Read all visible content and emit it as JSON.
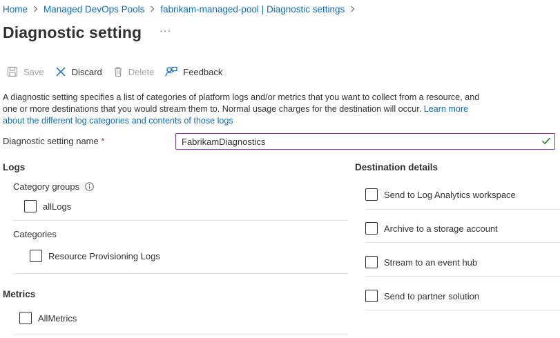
{
  "breadcrumb": [
    {
      "label": "Home"
    },
    {
      "label": "Managed DevOps Pools"
    },
    {
      "label": "fabrikam-managed-pool | Diagnostic settings"
    }
  ],
  "page_title": "Diagnostic setting",
  "more_label": "···",
  "toolbar": {
    "save": "Save",
    "discard": "Discard",
    "delete": "Delete",
    "feedback": "Feedback"
  },
  "description": {
    "text": "A diagnostic setting specifies a list of categories of platform logs and/or metrics that you want to collect from a resource, and one or more destinations that you would stream them to. Normal usage charges for the destination will occur. ",
    "link": "Learn more about the different log categories and contents of those logs"
  },
  "setting_name": {
    "label": "Diagnostic setting name",
    "required_mark": "*",
    "value": "FabrikamDiagnostics"
  },
  "logs": {
    "heading": "Logs",
    "category_groups_label": "Category groups",
    "category_groups": [
      {
        "label": "allLogs",
        "checked": false
      }
    ],
    "categories_label": "Categories",
    "categories": [
      {
        "label": "Resource Provisioning Logs",
        "checked": false
      }
    ]
  },
  "metrics": {
    "heading": "Metrics",
    "items": [
      {
        "label": "AllMetrics",
        "checked": false
      }
    ]
  },
  "destination": {
    "heading": "Destination details",
    "options": [
      {
        "label": "Send to Log Analytics workspace",
        "checked": false
      },
      {
        "label": "Archive to a storage account",
        "checked": false
      },
      {
        "label": "Stream to an event hub",
        "checked": false
      },
      {
        "label": "Send to partner solution",
        "checked": false
      }
    ]
  },
  "colors": {
    "link": "#0f6cbd",
    "input_border": "#8a2da5",
    "valid_check": "#107c10",
    "required": "#a4262c",
    "disabled_text": "#a19f9d"
  },
  "icons": {
    "save": "save-icon",
    "discard": "close-icon",
    "delete": "trash-icon",
    "feedback": "feedback-icon",
    "valid": "checkmark-icon",
    "info": "info-icon"
  }
}
